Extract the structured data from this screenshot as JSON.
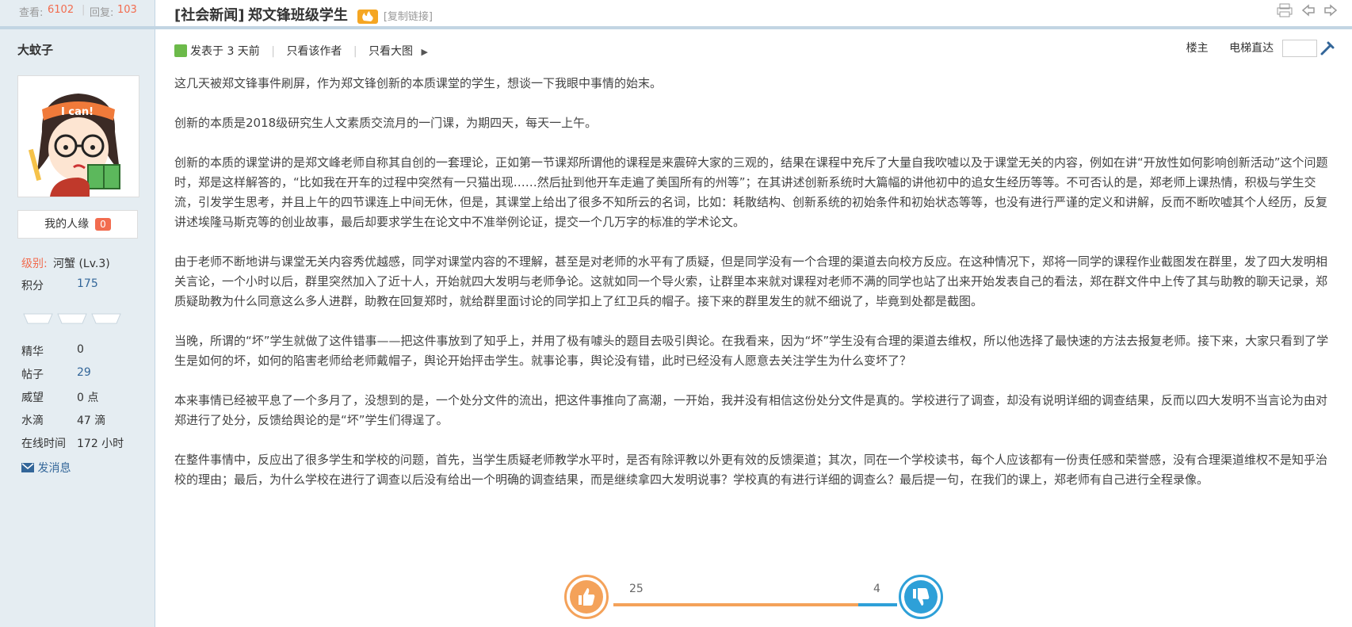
{
  "stats": {
    "views_label": "查看:",
    "views": "6102",
    "replies_label": "回复:",
    "replies": "103"
  },
  "thread": {
    "category": "[社会新闻]",
    "title": "郑文锋班级学生",
    "copy_link": "[复制链接]"
  },
  "user": {
    "name": "大蚊子",
    "popularity_label": "我的人缘",
    "popularity": "0",
    "level_label": "级别:",
    "level": "河蟹 (Lv.3)",
    "points_label": "积分",
    "points": "175",
    "essence_label": "精华",
    "essence": "0",
    "posts_label": "帖子",
    "posts": "29",
    "prestige_label": "威望",
    "prestige": "0 点",
    "water_label": "水滴",
    "water": "47 滴",
    "online_label": "在线时间",
    "online": "172 小时",
    "message_link": "发消息"
  },
  "post": {
    "posted": "发表于 3 天前",
    "only_author": "只看该作者",
    "big_image": "只看大图",
    "floor": "楼主",
    "elevator": "电梯直达",
    "paragraphs": [
      "这几天被郑文锋事件刷屏，作为郑文锋创新的本质课堂的学生，想谈一下我眼中事情的始末。",
      "创新的本质是2018级研究生人文素质交流月的一门课，为期四天，每天一上午。",
      "创新的本质的课堂讲的是郑文峰老师自称其自创的一套理论，正如第一节课郑所谓他的课程是来震碎大家的三观的，结果在课程中充斥了大量自我吹嘘以及于课堂无关的内容，例如在讲“开放性如何影响创新活动”这个问题时，郑是这样解答的，“比如我在开车的过程中突然有一只猫出现……然后扯到他开车走遍了美国所有的州等”；在其讲述创新系统时大篇幅的讲他初中的追女生经历等等。不可否认的是，郑老师上课热情，积极与学生交流，引发学生思考，并且上午的四节课连上中间无休，但是，其课堂上给出了很多不知所云的名词，比如：耗散结构、创新系统的初始条件和初始状态等等，也没有进行严谨的定义和讲解，反而不断吹嘘其个人经历，反复讲述埃隆马斯克等的创业故事，最后却要求学生在论文中不准举例论证，提交一个几万字的标准的学术论文。",
      "由于老师不断地讲与课堂无关内容秀优越感，同学对课堂内容的不理解，甚至是对老师的水平有了质疑，但是同学没有一个合理的渠道去向校方反应。在这种情况下，郑将一同学的课程作业截图发在群里，发了四大发明相关言论，一个小时以后，群里突然加入了近十人，开始就四大发明与老师争论。这就如同一个导火索，让群里本来就对课程对老师不满的同学也站了出来开始发表自己的看法，郑在群文件中上传了其与助教的聊天记录，郑质疑助教为什么同意这么多人进群，助教在回复郑时，就给群里面讨论的同学扣上了红卫兵的帽子。接下来的群里发生的就不细说了，毕竟到处都是截图。",
      "当晚，所谓的“坏”学生就做了这件错事——把这件事放到了知乎上，并用了极有噱头的题目去吸引舆论。在我看来，因为“坏”学生没有合理的渠道去维权，所以他选择了最快速的方法去报复老师。接下来，大家只看到了学生是如何的坏，如何的陷害老师给老师戴帽子，舆论开始抨击学生。就事论事，舆论没有错，此时已经没有人愿意去关注学生为什么变坏了？",
      "本来事情已经被平息了一个多月了，没想到的是，一个处分文件的流出，把这件事推向了高潮，一开始，我并没有相信这份处分文件是真的。学校进行了调查，却没有说明详细的调查结果，反而以四大发明不当言论为由对郑进行了处分，反馈给舆论的是“坏”学生们得逞了。",
      "在整件事情中，反应出了很多学生和学校的问题，首先，当学生质疑老师教学水平时，是否有除评教以外更有效的反馈渠道；其次，同在一个学校读书，每个人应该都有一份责任感和荣誉感，没有合理渠道维权不是知乎治校的理由；最后，为什么学校在进行了调查以后没有给出一个明确的调查结果，而是继续拿四大发明说事？学校真的有进行详细的调查么？最后提一句，在我们的课上，郑老师有自己进行全程录像。"
    ]
  },
  "vote": {
    "likes": "25",
    "dislikes": "4",
    "like_share": 0.862
  },
  "colors": {
    "accent_orange": "#f26c4f",
    "link_blue": "#336699",
    "like_orange": "#f4a25a",
    "dislike_blue": "#2ea0d8"
  }
}
